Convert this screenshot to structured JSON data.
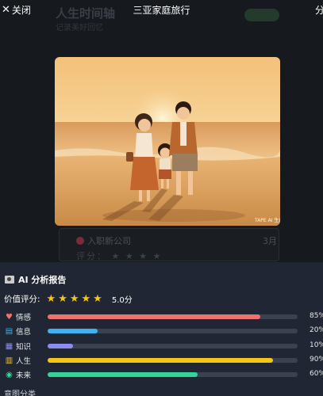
{
  "background": {
    "title": "人生时间轴",
    "subtitle": "记录美好回忆",
    "card_title": "入职新公司",
    "card_count": "3月",
    "card_rating_label": "评分："
  },
  "topbar": {
    "close_label": "关闭",
    "title": "三亚家庭旅行",
    "share_label": "分享"
  },
  "photo": {
    "watermark": "TAPE AI 生成"
  },
  "report": {
    "title": "AI 分析报告",
    "rating_label": "价值评分:",
    "stars": 5,
    "rating_value": "5.0分",
    "rows": [
      {
        "label": "情感",
        "value": 85,
        "pct": "85%",
        "color": "#f07070",
        "icon": "heart-icon"
      },
      {
        "label": "信息",
        "value": 20,
        "pct": "20%",
        "color": "#3fb1ef",
        "icon": "notepad-icon"
      },
      {
        "label": "知识",
        "value": 10,
        "pct": "10%",
        "color": "#8a8cf0",
        "icon": "books-icon"
      },
      {
        "label": "人生",
        "value": 90,
        "pct": "90%",
        "color": "#f5c518",
        "icon": "chart-icon"
      },
      {
        "label": "未来",
        "value": 60,
        "pct": "60%",
        "color": "#34d399",
        "icon": "crystal-ball-icon"
      }
    ],
    "trail_label": "意图分类"
  }
}
